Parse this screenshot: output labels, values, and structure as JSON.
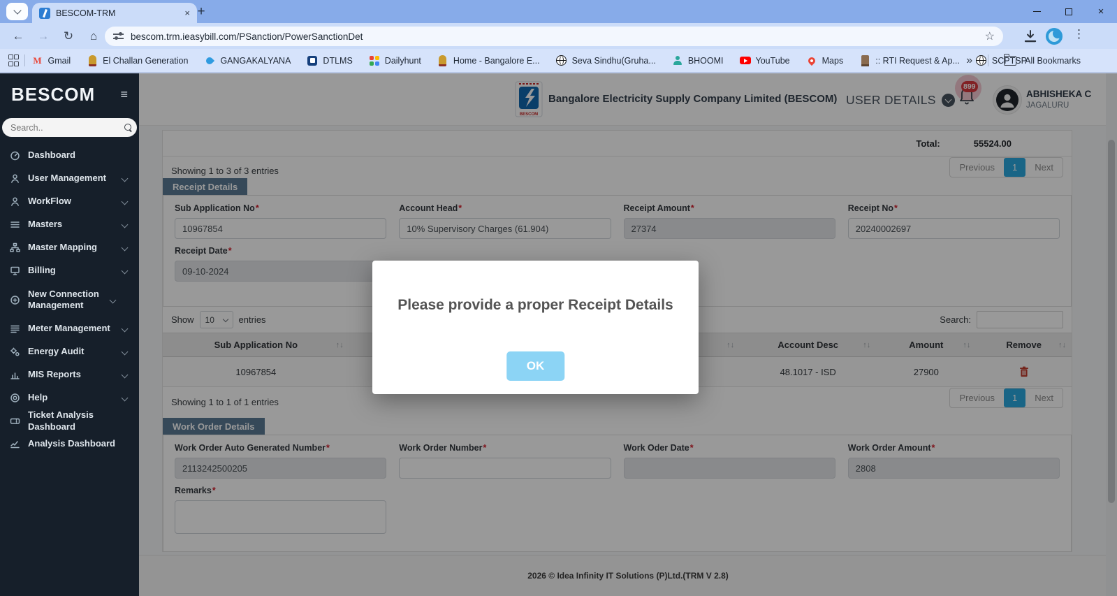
{
  "glyphs": {
    "hamburger": "≡",
    "new_tab": "+",
    "close_tab": "×",
    "back": "←",
    "forward": "→",
    "reload": "↻",
    "home": "⌂",
    "star": "☆",
    "dots": "⋮",
    "minimize": "–",
    "close_window": "×",
    "overflow": "»",
    "sort": "↑↓",
    "required": "*"
  },
  "browser": {
    "tab_title": "BESCOM-TRM",
    "url": "bescom.trm.ieasybill.com/PSanction/PowerSanctionDet",
    "bookmarks": [
      {
        "label": "Gmail"
      },
      {
        "label": "El Challan Generation"
      },
      {
        "label": "GANGAKALYANA"
      },
      {
        "label": "DTLMS"
      },
      {
        "label": "Dailyhunt"
      },
      {
        "label": "Home - Bangalore E..."
      },
      {
        "label": "Seva Sindhu(Gruha..."
      },
      {
        "label": "BHOOMI"
      },
      {
        "label": "YouTube"
      },
      {
        "label": "Maps"
      },
      {
        "label": ":: RTI Request & Ap..."
      },
      {
        "label": "SCPTSP"
      }
    ],
    "all_bookmarks_label": "All Bookmarks"
  },
  "sidebar": {
    "brand": "BESCOM",
    "search_placeholder": "Search..",
    "items": [
      {
        "label": "Dashboard"
      },
      {
        "label": "User Management"
      },
      {
        "label": "WorkFlow"
      },
      {
        "label": "Masters"
      },
      {
        "label": "Master Mapping"
      },
      {
        "label": "Billing"
      },
      {
        "label": "New Connection Management"
      },
      {
        "label": "Meter Management"
      },
      {
        "label": "Energy Audit"
      },
      {
        "label": "MIS Reports"
      },
      {
        "label": "Help"
      },
      {
        "label": "Ticket Analysis Dashboard"
      },
      {
        "label": "Analysis Dashboard"
      }
    ]
  },
  "header": {
    "company_name": "Bangalore Electricity Supply Company Limited (BESCOM)",
    "logo_text": "BESCOM",
    "user_details_label": "USER DETAILS",
    "notification_count": "899",
    "user_name": "ABHISHEKA C",
    "user_location": "JAGALURU"
  },
  "summary": {
    "total_label": "Total:",
    "total_value": "55524.00",
    "showing_text": "Showing 1 to 3 of 3 entries"
  },
  "pagination": {
    "previous": "Previous",
    "page": "1",
    "next": "Next"
  },
  "receipt": {
    "section_title": "Receipt Details",
    "sub_application_no": {
      "label": "Sub Application No",
      "value": "10967854"
    },
    "account_head": {
      "label": "Account Head",
      "value": "10% Supervisory Charges (61.904)"
    },
    "receipt_amount": {
      "label": "Receipt Amount",
      "value": "27374"
    },
    "receipt_no": {
      "label": "Receipt No",
      "value": "20240002697"
    },
    "receipt_date": {
      "label": "Receipt Date",
      "value": "09-10-2024"
    }
  },
  "receipt_table": {
    "show_label": "Show",
    "page_size": "10",
    "entries_label": "entries",
    "search_label": "Search:",
    "columns": {
      "col1": "Sub Application No",
      "col2": "",
      "col3": "Account Desc",
      "col4": "Amount",
      "col5": "Remove"
    },
    "row": {
      "sub_application_no": "10967854",
      "col2": "",
      "account_desc": "48.1017 - ISD",
      "amount": "27900"
    },
    "showing_text": "Showing 1 to 1 of 1 entries"
  },
  "work_order": {
    "section_title": "Work Order Details",
    "auto_generated_number": {
      "label": "Work Order Auto Generated Number",
      "value": "2113242500205"
    },
    "order_number": {
      "label": "Work Order Number",
      "value": ""
    },
    "order_date": {
      "label": "Work Oder Date",
      "value": ""
    },
    "order_amount": {
      "label": "Work Order Amount",
      "value": "2808"
    },
    "remarks": {
      "label": "Remarks",
      "value": ""
    }
  },
  "modal": {
    "message": "Please provide a proper Receipt Details",
    "ok_label": "OK"
  },
  "footer": {
    "text": "2026 © Idea Infinity IT Solutions (P)Ltd.(TRM V 2.8)"
  },
  "colors": {
    "pagination_active": "#2aa9e0",
    "section_tab": "#5a7a94",
    "ok_button": "#8cd4f5",
    "badge": "#d8363d",
    "sidebar_bg": "#161f2a",
    "chrome_blue": "#87abe9"
  }
}
